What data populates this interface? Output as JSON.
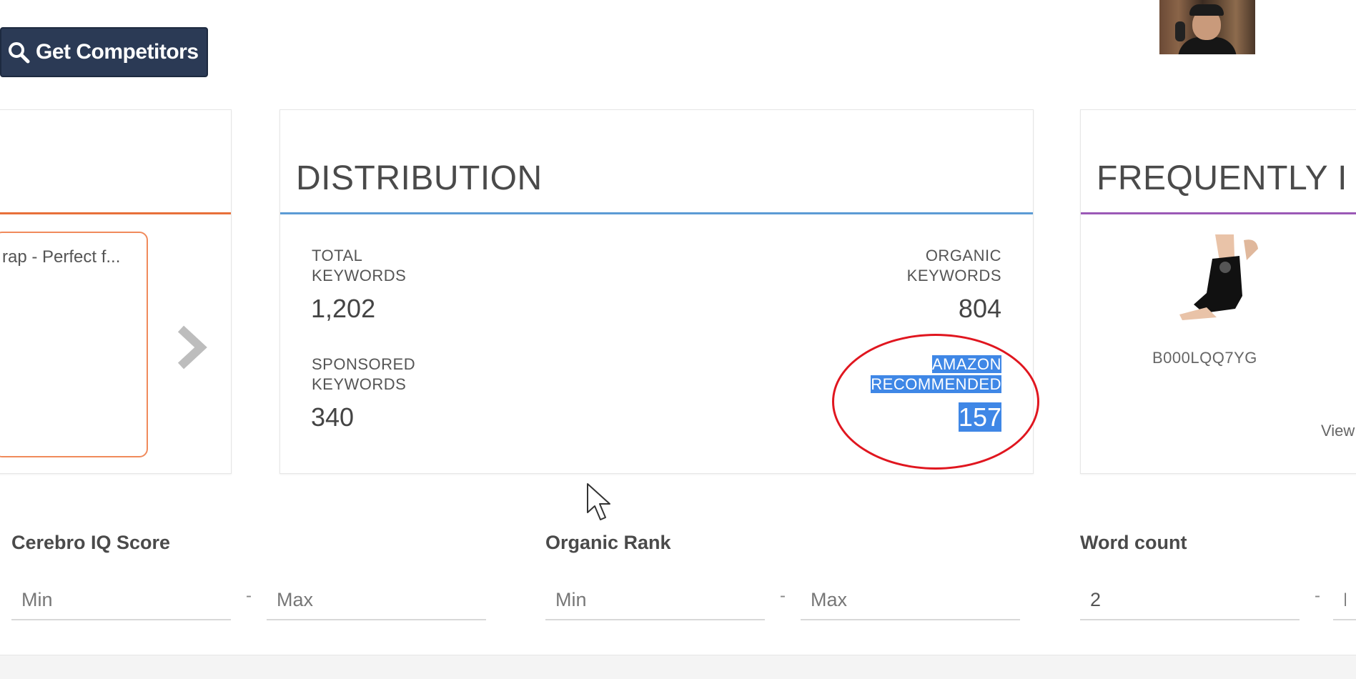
{
  "toolbar": {
    "get_competitors_label": "Get Competitors"
  },
  "left_card": {
    "product_name": "rap - Perfect f..."
  },
  "distribution": {
    "title": "DISTRIBUTION",
    "total_keywords": {
      "label_line1": "TOTAL",
      "label_line2": "KEYWORDS",
      "value": "1,202"
    },
    "organic_keywords": {
      "label_line1": "ORGANIC",
      "label_line2": "KEYWORDS",
      "value": "804"
    },
    "sponsored_keywords": {
      "label_line1": "SPONSORED",
      "label_line2": "KEYWORDS",
      "value": "340"
    },
    "amazon_recommended": {
      "label_line1": "AMAZON",
      "label_line2": "RECOMMENDED",
      "value": "157"
    }
  },
  "frequently": {
    "title": "FREQUENTLY I",
    "asin": "B000LQQ7YG",
    "view_link": "View"
  },
  "filters": {
    "cerebro_iq": {
      "label": "Cerebro IQ Score",
      "min_placeholder": "Min",
      "max_placeholder": "Max",
      "separator": "-"
    },
    "organic_rank": {
      "label": "Organic Rank",
      "min_placeholder": "Min",
      "max_placeholder": "Max",
      "separator": "-"
    },
    "word_count": {
      "label": "Word count",
      "min_value": "2",
      "max_placeholder": "M",
      "separator": "-"
    }
  },
  "colors": {
    "button_bg": "#2b3a55",
    "left_accent": "#e8703a",
    "distribution_accent": "#5b9bd5",
    "frequently_accent": "#9b59b6",
    "selection_highlight": "#3f87e6",
    "annotation_circle": "#e0161f"
  }
}
